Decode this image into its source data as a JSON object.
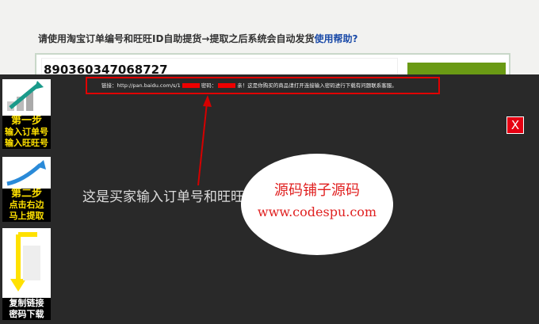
{
  "page": {
    "instruction_text": "请使用淘宝订单编号和旺旺ID自助提货→提取之后系统会自动发货",
    "help_link": "使用帮助?",
    "order_number": "890360347068727"
  },
  "modal": {
    "link_text_prefix": "链接：http://pan.baidu.com/s/1",
    "link_text_mid": "密码：",
    "link_text_suffix": "亲！这是你购买的商品请打开连接输入密码进行下载有问题联系客服。",
    "close_label": "X",
    "caption": "这是买家输入订单号和旺旺ID后提取的链接",
    "watermark_line1": "源码铺子源码",
    "watermark_line2": "www.codespu.com",
    "arrow_color": "#e00000"
  },
  "steps": [
    {
      "title": "第一步",
      "lines": [
        "输入订单号",
        "输入旺旺号"
      ]
    },
    {
      "title": "第二步",
      "lines": [
        "点击右边",
        "马上提取"
      ]
    },
    {
      "title": "",
      "lines": [
        "复制链接",
        "密码下载"
      ]
    }
  ]
}
